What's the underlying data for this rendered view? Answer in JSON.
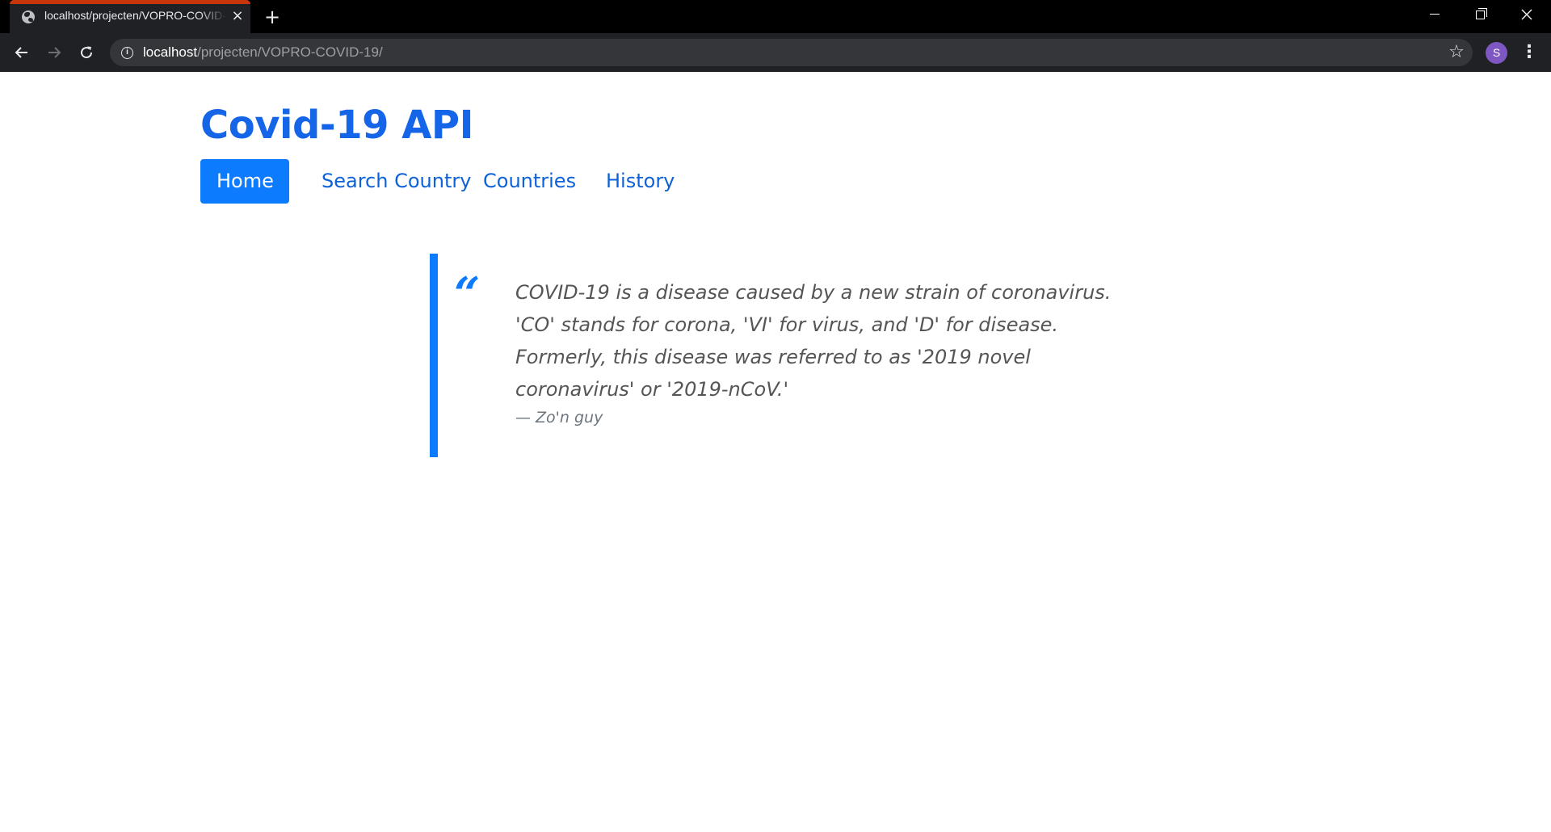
{
  "browser": {
    "tab_title": "localhost/projecten/VOPRO-COVID-19/",
    "tab_close_icon": "×",
    "new_tab_icon": "+",
    "url_host": "localhost",
    "url_path": "/projecten/VOPRO-COVID-19/",
    "info_icon": "i",
    "profile_initial": "S",
    "profile_color": "#7e57c2",
    "tab_accent_color": "#c9360c"
  },
  "site": {
    "title": "Covid-19 API",
    "brand_color": "#1565e8",
    "accent_color": "#0d7bfd"
  },
  "nav": {
    "items": [
      {
        "label": "Home",
        "active": true
      },
      {
        "label": "Search Country",
        "active": false
      },
      {
        "label": "Countries",
        "active": false
      },
      {
        "label": "History",
        "active": false
      }
    ]
  },
  "quote": {
    "mark": "“",
    "lines": [
      "COVID-19 is a disease caused by a new strain of coronavirus.",
      "'CO' stands for corona, 'VI' for virus, and 'D' for disease.",
      "Formerly, this disease was referred to as '2019 novel",
      "coronavirus' or '2019-nCoV.'"
    ],
    "author": "— Zo'n guy"
  }
}
